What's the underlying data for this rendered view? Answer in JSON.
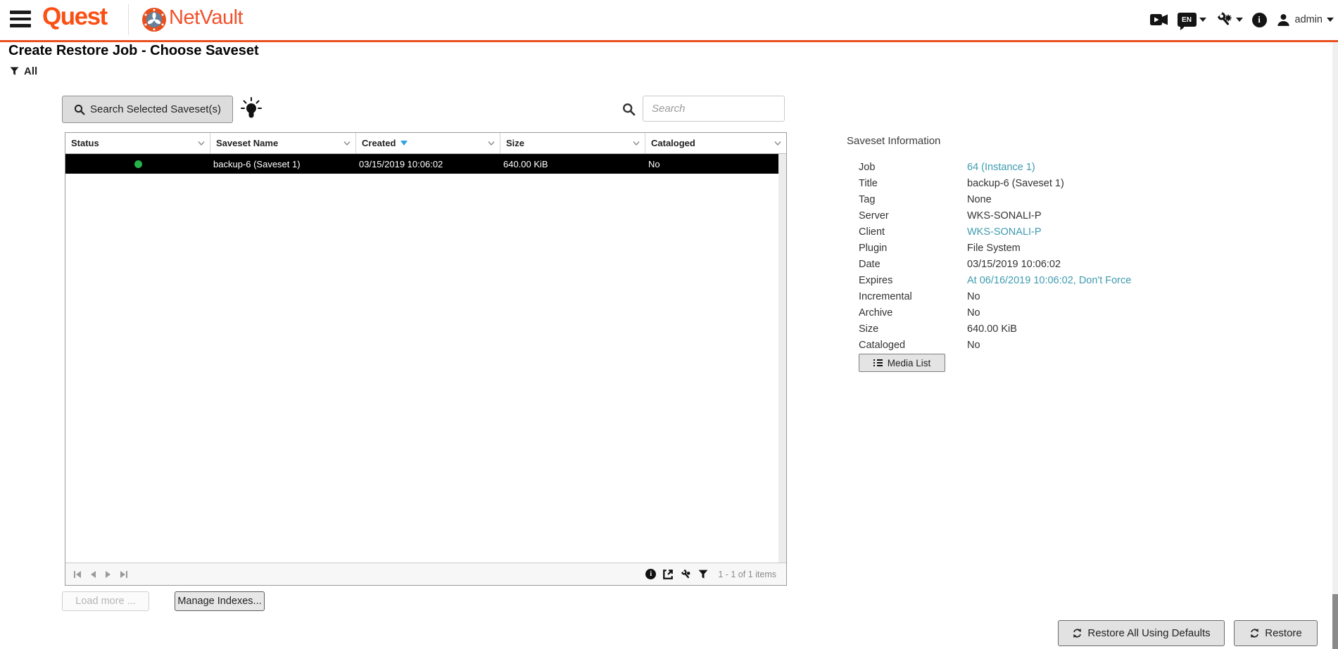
{
  "topbar": {
    "brand_quest": "Quest",
    "brand_product": "NetVault",
    "language": "EN",
    "user": "admin"
  },
  "page": {
    "title": "Create Restore Job - Choose Saveset",
    "filter_label": "All"
  },
  "toolbar": {
    "search_selected_button": "Search Selected Saveset(s)",
    "search_placeholder": "Search"
  },
  "table": {
    "columns": [
      "Status",
      "Saveset Name",
      "Created",
      "Size",
      "Cataloged"
    ],
    "sorted_column": "Created",
    "sort_direction": "descending",
    "rows": [
      {
        "status": "green",
        "saveset_name": "backup-6 (Saveset 1)",
        "created": "03/15/2019 10:06:02",
        "size": "640.00 KiB",
        "cataloged": "No",
        "selected": true
      }
    ],
    "pagination_summary": "1 - 1 of 1 items"
  },
  "saveset_info": {
    "heading": "Saveset Information",
    "fields": [
      {
        "label": "Job",
        "value": "64 (Instance 1)",
        "link": true
      },
      {
        "label": "Title",
        "value": "backup-6 (Saveset 1)"
      },
      {
        "label": "Tag",
        "value": "None"
      },
      {
        "label": "Server",
        "value": "WKS-SONALI-P"
      },
      {
        "label": "Client",
        "value": "WKS-SONALI-P",
        "link": true
      },
      {
        "label": "Plugin",
        "value": "File System"
      },
      {
        "label": "Date",
        "value": "03/15/2019 10:06:02"
      },
      {
        "label": "Expires",
        "value": "At 06/16/2019 10:06:02, Don't Force",
        "link": true
      },
      {
        "label": "Incremental",
        "value": "No"
      },
      {
        "label": "Archive",
        "value": "No"
      },
      {
        "label": "Size",
        "value": "640.00 KiB"
      },
      {
        "label": "Cataloged",
        "value": "No"
      }
    ],
    "media_list_button": "Media List"
  },
  "actions": {
    "load_more": "Load more ...",
    "manage_indexes": "Manage Indexes...",
    "restore_all": "Restore All Using Defaults",
    "restore": "Restore"
  },
  "colors": {
    "brand_orange": "#fb4f14",
    "divider_orange": "#e8501f",
    "link_teal": "#3e9bb0",
    "status_green": "#25b24b",
    "sort_blue": "#2fa3e0",
    "selected_row_bg": "#000000"
  }
}
